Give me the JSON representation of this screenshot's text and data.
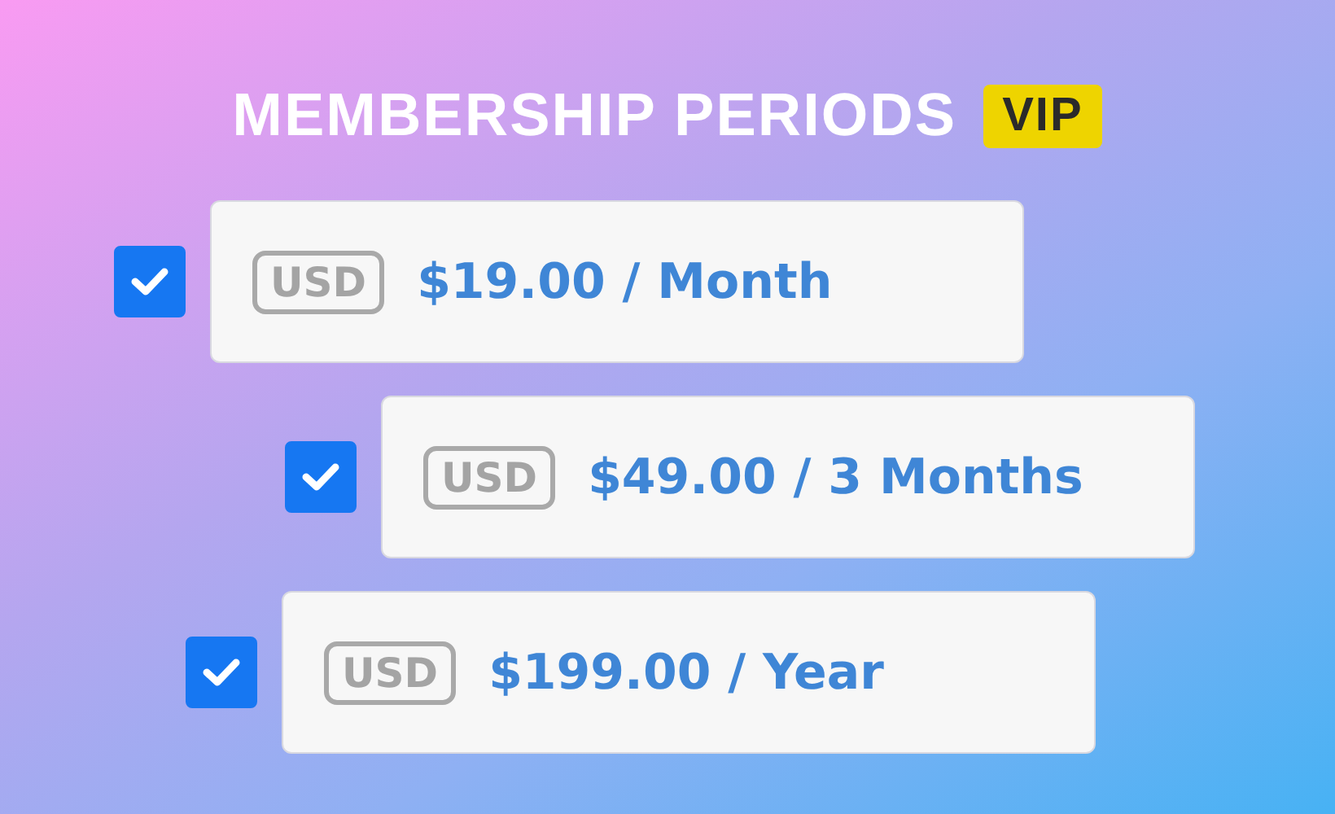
{
  "title": "MEMBERSHIP PERIODS",
  "badge": "VIP",
  "plans": [
    {
      "currency": "USD",
      "price": "$19.00 / Month",
      "checked": true
    },
    {
      "currency": "USD",
      "price": "$49.00 / 3 Months",
      "checked": true
    },
    {
      "currency": "USD",
      "price": "$199.00 / Year",
      "checked": true
    }
  ]
}
